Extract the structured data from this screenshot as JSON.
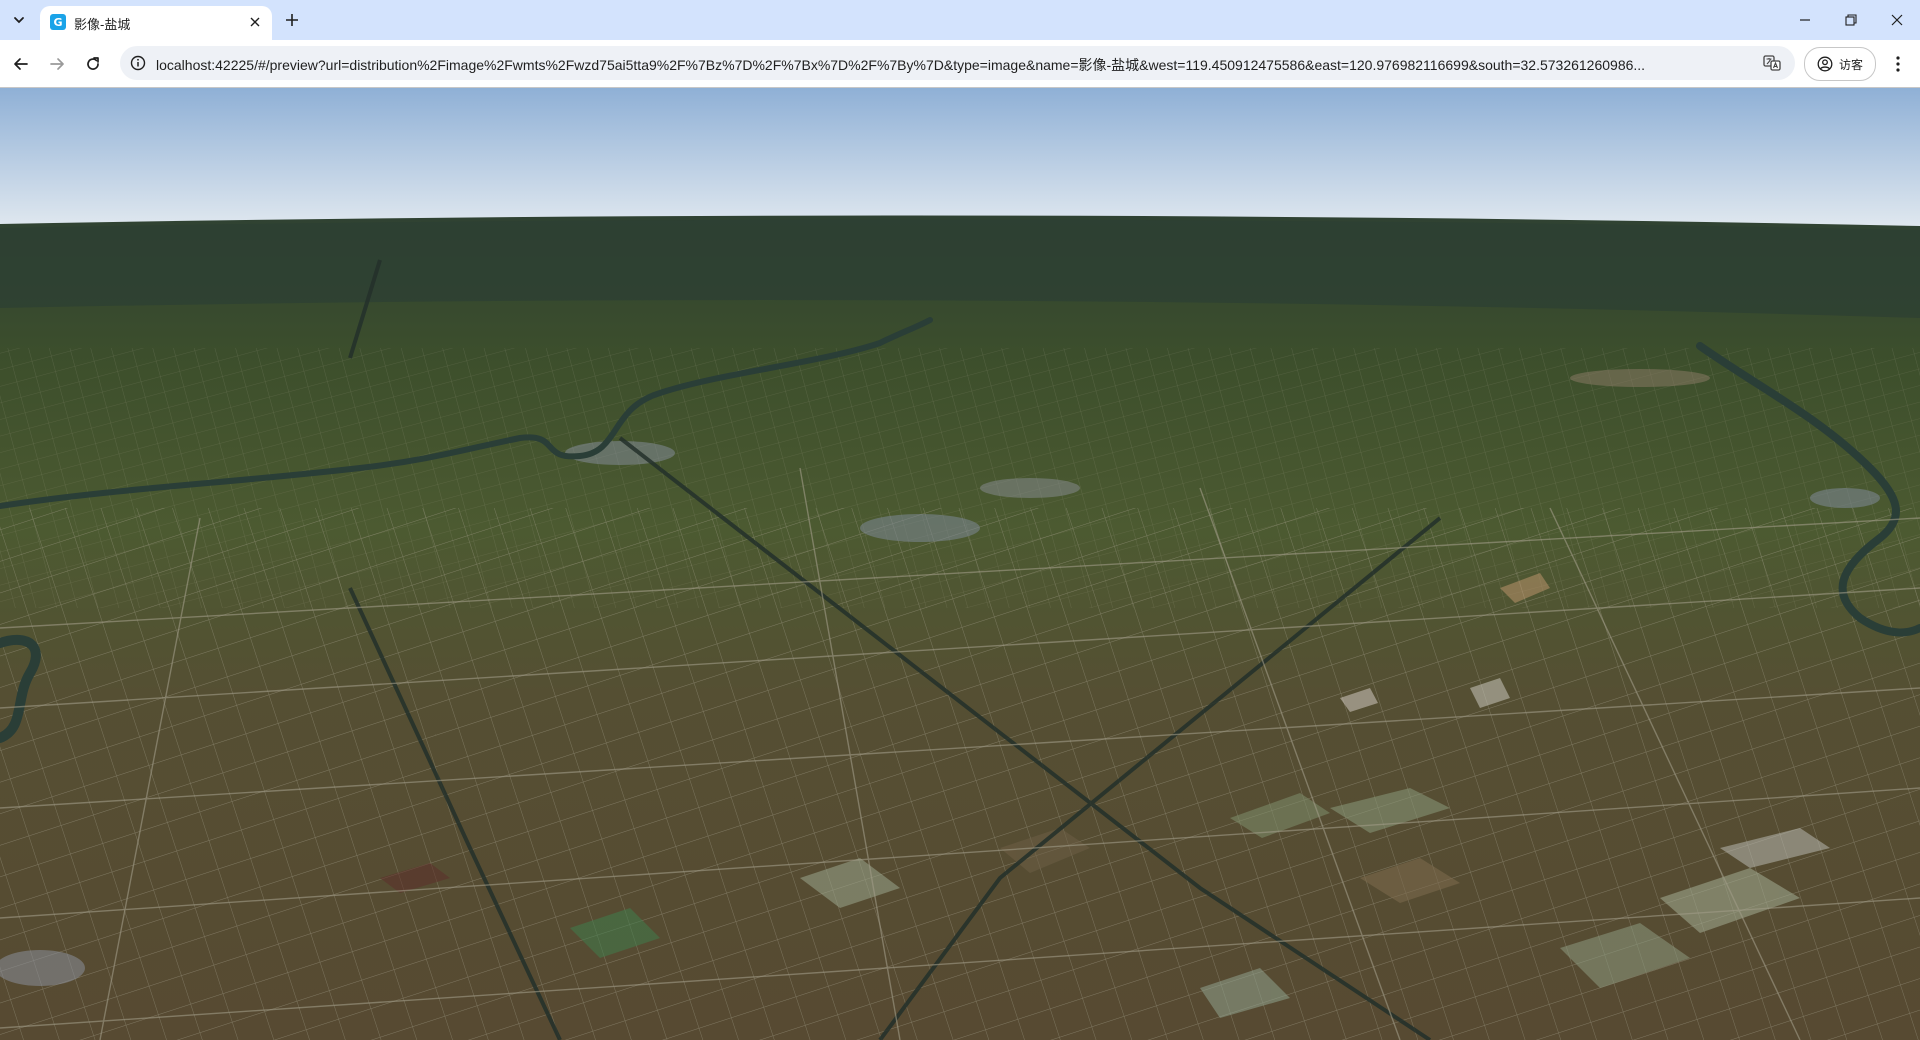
{
  "browser": {
    "tab": {
      "title": "影像-盐城",
      "favicon_letter": "G"
    },
    "address_bar": {
      "url": "localhost:42225/#/preview?url=distribution%2Fimage%2Fwmts%2Fwzd75ai5tta9%2F%7Bz%7D%2F%7Bx%7D%2F%7By%7D&type=image&name=影像-盐城&west=119.450912475586&east=120.976982116699&south=32.573261260986..."
    },
    "profile": {
      "label": "访客"
    }
  },
  "map": {
    "layer_name": "影像-盐城",
    "layer_type": "image",
    "bounds": {
      "west": 119.450912475586,
      "east": 120.976982116699,
      "south": 32.573261260986
    },
    "view": "3D oblique satellite imagery",
    "colors": {
      "sky_top": "#8fb0d6",
      "sky_horizon": "#e6ecf1",
      "ground_far": "#2f4232",
      "ground_mid": "#4c5a31",
      "ground_near": "#574a32",
      "river": "#2a3e37",
      "road": "#a19c88"
    }
  },
  "icons": {
    "tab_search": "chevron-down-icon",
    "close_tab": "close-icon",
    "new_tab": "plus-icon",
    "back": "arrow-left-icon",
    "forward": "arrow-right-icon",
    "reload": "reload-icon",
    "site_info": "info-icon",
    "translate": "translate-icon",
    "profile": "user-circle-icon",
    "menu": "kebab-menu-icon",
    "minimize": "minimize-icon",
    "restore": "restore-icon",
    "close_window": "close-window-icon"
  }
}
